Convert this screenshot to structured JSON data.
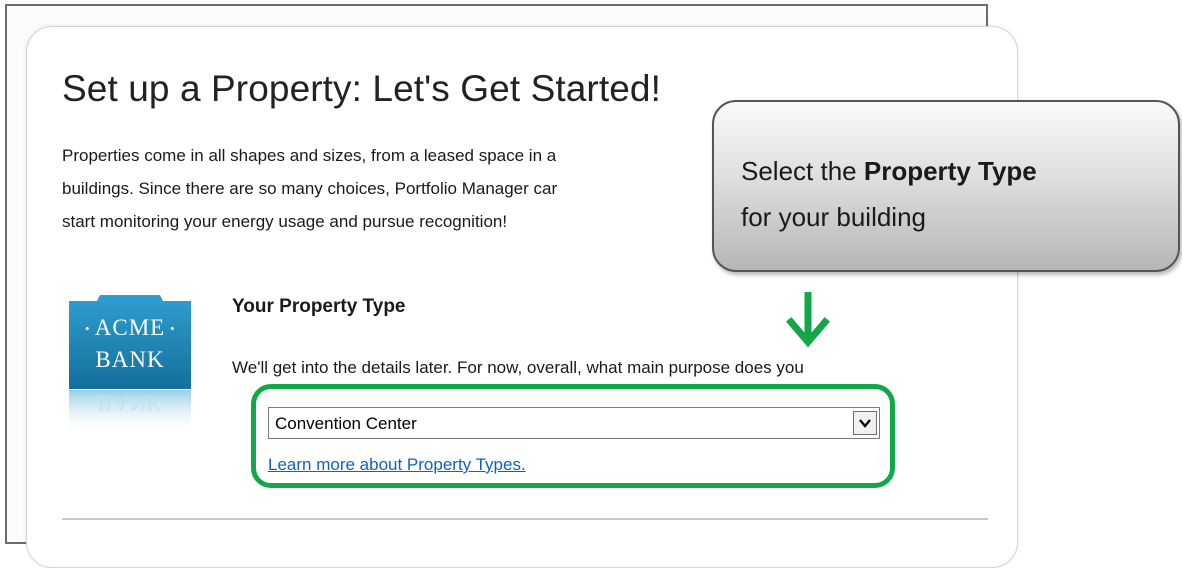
{
  "page": {
    "title": "Set up a Property: Let's Get Started!",
    "intro_lines": [
      "Properties come in all shapes and sizes, from a leased space in a",
      "buildings. Since there are so many choices, Portfolio Manager car",
      "start monitoring your energy usage and pursue recognition!"
    ]
  },
  "logo": {
    "line1": "ACME",
    "line2": "BANK",
    "reflection": "BANK",
    "color": "#1c86b8"
  },
  "property_type": {
    "heading": "Your Property Type",
    "question": "We'll get into the details later. For now, overall, what main purpose does you",
    "selected_value": "Convention Center",
    "learn_more_link": "Learn more about Property Types."
  },
  "callout": {
    "text_before": "Select the ",
    "text_bold": "Property Type",
    "text_after": "for your building"
  },
  "colors": {
    "highlight": "#12a84a",
    "arrow": "#12a84a",
    "link": "#1060c8"
  },
  "icons": {
    "select_arrow": "chevron-down-icon",
    "callout_arrow": "arrow-down-icon"
  }
}
